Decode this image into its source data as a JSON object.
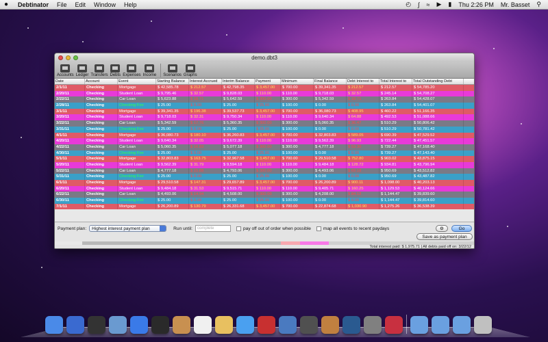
{
  "menubar": {
    "apple": "",
    "items": [
      "Debtinator",
      "File",
      "Edit",
      "Window",
      "Help"
    ],
    "clock": "Thu 2:26 PM",
    "user": "Mr. Basset"
  },
  "window": {
    "title": "demo.dbt3",
    "toolbar": [
      "Accounts",
      "Ledger",
      "Transfers",
      "Debts",
      "Expenses",
      "Income",
      "Scenarios",
      "Graphs"
    ]
  },
  "table": {
    "columns": [
      "Date",
      "Account",
      "Event",
      "Starting Balance",
      "Interest Accrued",
      "Interim Balance",
      "Payment",
      "Minimum",
      "Final Balance",
      "Debt Interest to",
      "Total Interest to",
      "Total Outstanding Debt"
    ],
    "rows": [
      {
        "kind": "mortgage",
        "cells": [
          "2/1/11",
          "Checking",
          "Mortgage",
          "$ 42,585.78",
          "$ 212.57",
          "$ 42,798.35",
          "$ 3,457.00",
          "$ 700.00",
          "$ 39,341.35",
          "$ 212.57",
          "$ 212.57",
          "$ 54,785.20"
        ]
      },
      {
        "kind": "student",
        "cells": [
          "2/20/11",
          "Checking",
          "Student Loan",
          "$ 9,795.46",
          "$ 32.57",
          "$ 9,828.03",
          "$ 110.00",
          "$ 110.00",
          "$ 9,718.03",
          "$ 32.57",
          "$ 245.14",
          "$ 54,708.27"
        ]
      },
      {
        "kind": "car",
        "cells": [
          "2/22/11",
          "Checking",
          "Car Loan",
          "$ 5,623.88",
          "$ 18.71",
          "$ 5,642.59",
          "$ 300.00",
          "$ 300.00",
          "$ 5,342.59",
          "$ 18.71",
          "$ 263.84",
          "$ 54,428.07"
        ]
      },
      {
        "kind": "checking",
        "cells": [
          "2/28/11",
          "Checking",
          "Checking Fee",
          "$ 25.00",
          "$ 0.00",
          "$ 25.00",
          "$ 25.00",
          "$ 100.00",
          "$ 0.00",
          "$ 0.00",
          "$ 263.84",
          "$ 54,401.07"
        ]
      },
      {
        "kind": "mortgage",
        "cells": [
          "3/1/11",
          "Checking",
          "Mortgage",
          "$ 39,341.35",
          "$ 196.38",
          "$ 39,537.73",
          "$ 3,457.00",
          "$ 700.00",
          "$ 36,080.73",
          "$ 408.95",
          "$ 460.22",
          "$ 51,166.35"
        ]
      },
      {
        "kind": "student",
        "cells": [
          "3/20/11",
          "Checking",
          "Student Loan",
          "$ 9,718.03",
          "$ 32.31",
          "$ 9,750.34",
          "$ 110.00",
          "$ 110.00",
          "$ 9,640.34",
          "$ 64.88",
          "$ 492.53",
          "$ 51,088.66"
        ]
      },
      {
        "kind": "car",
        "cells": [
          "3/22/11",
          "Checking",
          "Car Loan",
          "$ 5,342.59",
          "$ 17.76",
          "$ 5,360.35",
          "$ 300.00",
          "$ 300.00",
          "$ 5,060.35",
          "$ 36.47",
          "$ 510.29",
          "$ 50,806.42"
        ]
      },
      {
        "kind": "checking",
        "cells": [
          "3/31/11",
          "Checking",
          "Checking Fee",
          "$ 25.00",
          "$ 0.00",
          "$ 25.00",
          "$ 25.00",
          "$ 100.00",
          "$ 0.00",
          "$ 0.00",
          "$ 510.29",
          "$ 50,781.42"
        ]
      },
      {
        "kind": "mortgage",
        "cells": [
          "4/1/11",
          "Checking",
          "Mortgage",
          "$ 36,080.73",
          "$ 180.10",
          "$ 36,260.83",
          "$ 3,457.00",
          "$ 700.00",
          "$ 32,803.83",
          "$ 589.05",
          "$ 690.39",
          "$ 47,529.52"
        ]
      },
      {
        "kind": "student",
        "cells": [
          "4/20/11",
          "Checking",
          "Student Loan",
          "$ 9,640.34",
          "$ 32.05",
          "$ 9,672.39",
          "$ 110.00",
          "$ 110.00",
          "$ 9,562.39",
          "$ 96.93",
          "$ 722.44",
          "$ 47,451.57"
        ]
      },
      {
        "kind": "car",
        "cells": [
          "4/22/11",
          "Checking",
          "Car Loan",
          "$ 5,060.35",
          "$ 16.83",
          "$ 5,077.18",
          "$ 300.00",
          "$ 300.00",
          "$ 4,777.18",
          "$ 53.30",
          "$ 739.27",
          "$ 47,168.40"
        ]
      },
      {
        "kind": "checking",
        "cells": [
          "4/30/11",
          "Checking",
          "Checking Fee",
          "$ 25.00",
          "$ 0.00",
          "$ 25.00",
          "$ 25.00",
          "$ 100.00",
          "$ 0.00",
          "$ 0.00",
          "$ 739.27",
          "$ 47,143.40"
        ]
      },
      {
        "kind": "mortgage",
        "cells": [
          "5/1/11",
          "Checking",
          "Mortgage",
          "$ 32,803.83",
          "$ 163.75",
          "$ 32,967.58",
          "$ 3,457.00",
          "$ 700.00",
          "$ 29,510.58",
          "$ 752.80",
          "$ 903.02",
          "$ 43,875.15"
        ]
      },
      {
        "kind": "student",
        "cells": [
          "5/20/11",
          "Checking",
          "Student Loan",
          "$ 9,562.39",
          "$ 31.79",
          "$ 9,594.18",
          "$ 110.00",
          "$ 110.00",
          "$ 9,484.18",
          "$ 128.72",
          "$ 934.81",
          "$ 43,796.94"
        ]
      },
      {
        "kind": "car",
        "cells": [
          "5/22/11",
          "Checking",
          "Car Loan",
          "$ 4,777.18",
          "$ 15.88",
          "$ 4,793.06",
          "$ 300.00",
          "$ 300.00",
          "$ 4,493.06",
          "$ 69.18",
          "$ 950.69",
          "$ 43,512.82"
        ]
      },
      {
        "kind": "checking",
        "cells": [
          "5/31/11",
          "Checking",
          "Checking Fee",
          "$ 25.00",
          "$ 0.00",
          "$ 25.00",
          "$ 25.00",
          "$ 100.00",
          "$ 0.00",
          "$ 0.00",
          "$ 950.69",
          "$ 43,487.82"
        ]
      },
      {
        "kind": "mortgage",
        "cells": [
          "6/1/11",
          "Checking",
          "Mortgage",
          "$ 29,510.58",
          "$ 147.31",
          "$ 29,657.89",
          "$ 3,457.00",
          "$ 700.00",
          "$ 26,200.89",
          "$ 900.11",
          "$ 1,098.00",
          "$ 40,203.13"
        ]
      },
      {
        "kind": "student",
        "cells": [
          "6/20/11",
          "Checking",
          "Student Loan",
          "$ 9,484.18",
          "$ 31.53",
          "$ 9,515.71",
          "$ 110.00",
          "$ 110.00",
          "$ 9,405.71",
          "$ 160.25",
          "$ 1,129.53",
          "$ 40,124.66"
        ]
      },
      {
        "kind": "car",
        "cells": [
          "6/22/11",
          "Checking",
          "Car Loan",
          "$ 4,493.06",
          "$ 14.94",
          "$ 4,508.00",
          "$ 300.00",
          "$ 300.00",
          "$ 4,208.00",
          "$ 84.12",
          "$ 1,144.47",
          "$ 39,839.60"
        ]
      },
      {
        "kind": "checking",
        "cells": [
          "6/30/11",
          "Checking",
          "Checking Fee",
          "$ 25.00",
          "$ 0.00",
          "$ 25.00",
          "$ 25.00",
          "$ 100.00",
          "$ 0.00",
          "$ 0.00",
          "$ 1,144.47",
          "$ 39,814.60"
        ]
      },
      {
        "kind": "mortgage",
        "cells": [
          "7/1/11",
          "Checking",
          "Mortgage",
          "$ 26,200.89",
          "$ 130.79",
          "$ 26,331.68",
          "$ 3,457.00",
          "$ 700.00",
          "$ 22,874.68",
          "$ 1,030.90",
          "$ 1,275.26",
          "$ 36,538.39"
        ]
      }
    ]
  },
  "controls": {
    "plan_label": "Payment plan:",
    "plan_value": "Highest interest payment plan",
    "run_until_label": "Run until:",
    "run_until_placeholder": "complete",
    "out_of_order_label": "pay off out of order when possible",
    "map_events_label": "map all events to recent paydays",
    "go_label": "Go",
    "save_label": "Save as payment plan",
    "status": "Total interest paid: $ 1,975.71 | All debts paid off on: 3/22/12"
  },
  "colors": {
    "mortgage": "#e05a66",
    "student": "#e83ad8",
    "car": "#7a7a86",
    "checking": "#3aa0c8",
    "account_text": "#30ff50"
  },
  "dock": {
    "icons": [
      "finder-icon",
      "app-store-icon",
      "dashboard-icon",
      "mail-icon",
      "safari-icon",
      "facetime-icon",
      "address-book-icon",
      "ical-icon",
      "preview-icon",
      "itunes-icon",
      "photo-booth-icon",
      "iphoto-icon",
      "imovie-icon",
      "garageband-icon",
      "time-machine-icon",
      "system-preferences-icon",
      "debtinator-icon",
      "applications-folder-icon",
      "documents-folder-icon",
      "downloads-folder-icon",
      "trash-icon"
    ]
  }
}
